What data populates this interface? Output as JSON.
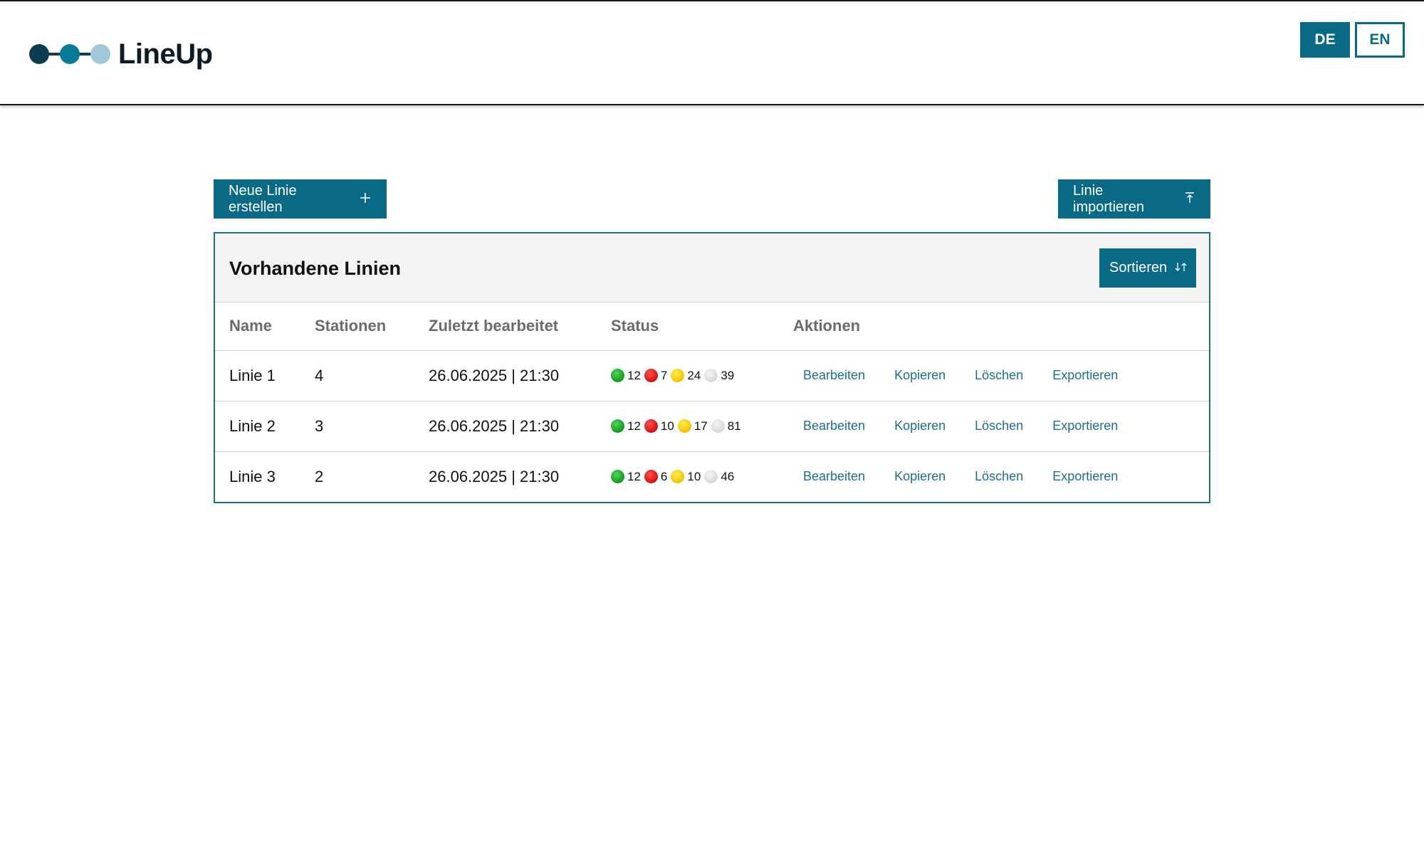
{
  "header": {
    "app_name": "LineUp",
    "languages": [
      "DE",
      "EN"
    ],
    "logo_colors": [
      "#0d3b4f",
      "#0a7a99",
      "#9fc7d8"
    ]
  },
  "toolbar": {
    "new_line_label": "Neue Linie erstellen",
    "new_line_icon": "plus-icon",
    "import_label": "Linie importieren",
    "import_icon": "upload-icon"
  },
  "panel": {
    "title": "Vorhandene Linien",
    "sort_label": "Sortieren",
    "sort_icon": "sort-icon"
  },
  "table": {
    "columns": [
      "Name",
      "Stationen",
      "Zuletzt bearbeitet",
      "Status",
      "Aktionen"
    ],
    "action_labels": [
      "Bearbeiten",
      "Kopieren",
      "Löschen",
      "Exportieren"
    ],
    "rows": [
      {
        "name": "Linie 1",
        "stations": "4",
        "edited": "26.06.2025 | 21:30",
        "status": {
          "green": "12",
          "red": "7",
          "yellow": "24",
          "grey": "39"
        }
      },
      {
        "name": "Linie 2",
        "stations": "3",
        "edited": "26.06.2025 | 21:30",
        "status": {
          "green": "12",
          "red": "10",
          "yellow": "17",
          "grey": "81"
        }
      },
      {
        "name": "Linie 3",
        "stations": "2",
        "edited": "26.06.2025 | 21:30",
        "status": {
          "green": "12",
          "red": "6",
          "yellow": "10",
          "grey": "46"
        }
      }
    ]
  },
  "colors": {
    "accent": "#0a6a86",
    "status_green": "#18a526",
    "status_red": "#e01e1e",
    "status_yellow": "#f6d000",
    "status_grey": "#e2e2e2"
  }
}
